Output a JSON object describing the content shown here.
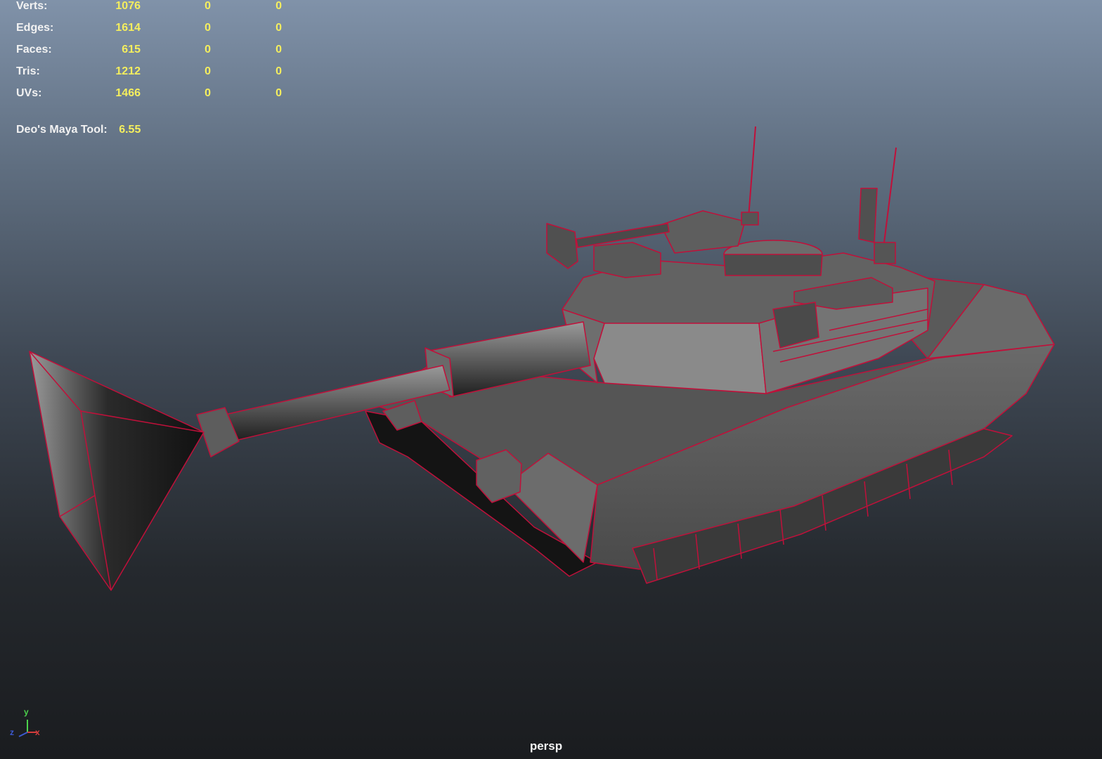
{
  "hud": {
    "stats": [
      {
        "label": "Verts:",
        "values": [
          "1076",
          "0",
          "0"
        ]
      },
      {
        "label": "Edges:",
        "values": [
          "1614",
          "0",
          "0"
        ]
      },
      {
        "label": "Faces:",
        "values": [
          "615",
          "0",
          "0"
        ]
      },
      {
        "label": "Tris:",
        "values": [
          "1212",
          "0",
          "0"
        ]
      },
      {
        "label": "UVs:",
        "values": [
          "1466",
          "0",
          "0"
        ]
      }
    ],
    "tool": {
      "label": "Deo's Maya Tool:",
      "value": "6.55"
    }
  },
  "viewport": {
    "camera": "persp",
    "axis": {
      "y": "y",
      "x": "x",
      "z": "z"
    }
  },
  "colors": {
    "wire": "#c0103a",
    "value_text": "#f4ee5e",
    "label_text": "#f2f2f2"
  }
}
